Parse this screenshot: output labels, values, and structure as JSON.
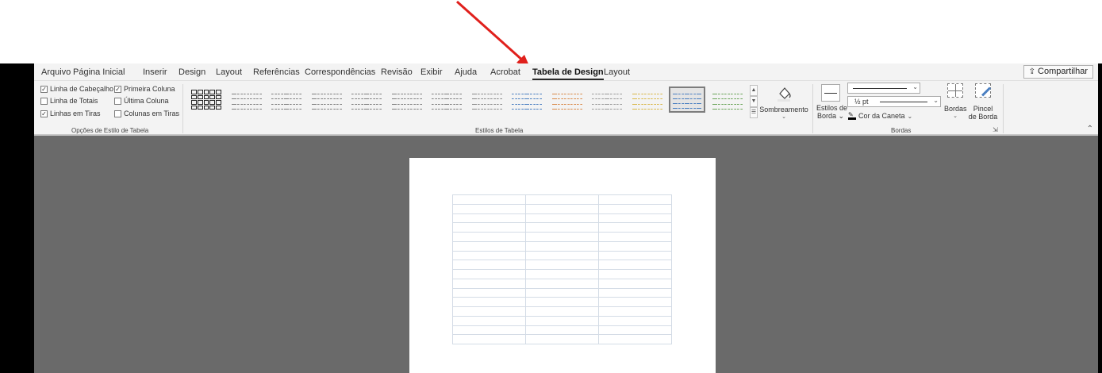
{
  "ribbon_tabs": [
    "Arquivo",
    "Página Inicial",
    "Inserir",
    "Design",
    "Layout",
    "Referências",
    "Correspondências",
    "Revisão",
    "Exibir",
    "Ajuda",
    "Acrobat",
    "Tabela de Design",
    "Layout"
  ],
  "active_tab": "Tabela de Design",
  "share_label": "Compartilhar",
  "table_style_options": {
    "header_row": "Linha de Cabeçalho",
    "first_column": "Primeira Coluna",
    "total_row": "Linha de Totais",
    "last_column": "Última Coluna",
    "banded_rows": "Linhas em Tiras",
    "banded_columns": "Colunas em Tiras",
    "group_label": "Opções de Estilo de Tabela"
  },
  "table_styles": {
    "group_label": "Estilos de Tabela",
    "shading_label": "Sombreamento",
    "thumb_colors": [
      "#222222",
      "#7f7f7f",
      "#7f7f7f",
      "#7f7f7f",
      "#7f7f7f",
      "#7f7f7f",
      "#7f7f7f",
      "#8a8a8a",
      "#4a7fc1",
      "#d98b4b",
      "#9a9a9a",
      "#d9b84a",
      "#4a7fc1",
      "#6ba55a"
    ],
    "selected_index": 12
  },
  "borders": {
    "border_styles_label_1": "Estilos de",
    "border_styles_label_2": "Borda",
    "weight_value": "½ pt",
    "pen_color_label": "Cor da Caneta",
    "borders_label": "Bordas",
    "border_painter_1": "Pincel",
    "border_painter_2": "de Borda",
    "group_label": "Bordas"
  },
  "colors": {
    "annotation_arrow": "#e0201c",
    "ribbon_bg": "#f3f3f3",
    "document_bg": "#6a6a6a"
  }
}
